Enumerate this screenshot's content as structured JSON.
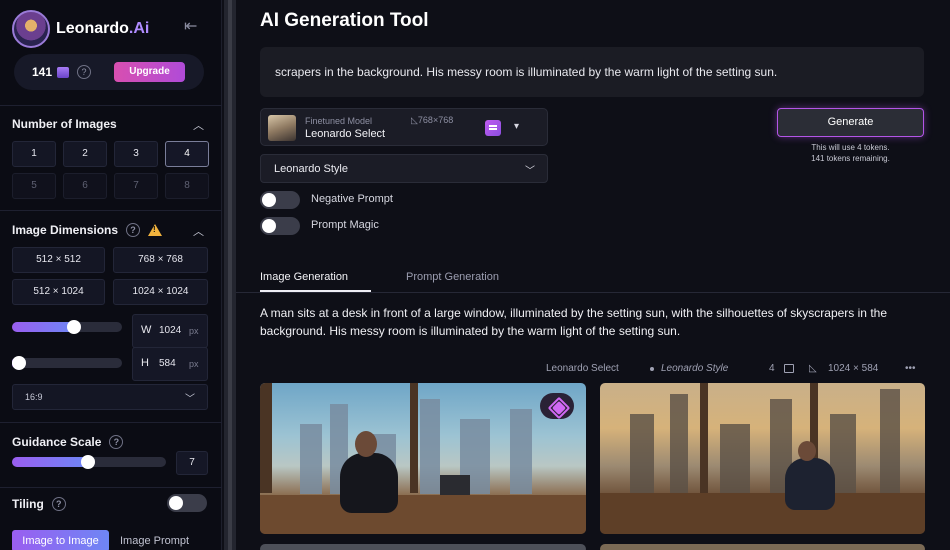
{
  "app": {
    "brand_prefix": "Leonardo",
    "brand_suffix": ".Ai",
    "collapse_icon": "arrow-left-to-line-icon"
  },
  "tokens": {
    "count": "141",
    "upgrade_label": "Upgrade"
  },
  "sidebar": {
    "num_images_title": "Number of Images",
    "num_images": [
      "1",
      "2",
      "3",
      "4",
      "5",
      "6",
      "7",
      "8"
    ],
    "num_images_selected": "4",
    "dimensions_title": "Image Dimensions",
    "dimension_presets": [
      "512 × 512",
      "768 × 768",
      "512 × 1024",
      "1024 × 1024"
    ],
    "width_label": "W",
    "width_value": "1024",
    "width_unit": "px",
    "width_slider": 0.5,
    "height_label": "H",
    "height_value": "584",
    "height_unit": "px",
    "height_slider": 0.0,
    "aspect_ratio": "16:9",
    "guidance_title": "Guidance Scale",
    "guidance_value": "7",
    "guidance_slider": 0.45,
    "tiling_title": "Tiling",
    "tiling_on": false,
    "tab_image_to_image": "Image to Image",
    "tab_image_prompt": "Image Prompt"
  },
  "main": {
    "title": "AI Generation Tool",
    "prompt_text": "scrapers in the background. His messy room is illuminated by the warm light of the setting sun.",
    "model_kicker": "Finetuned Model",
    "model_name": "Leonardo Select",
    "model_dims": "768×768",
    "style": "Leonardo Style",
    "negative_prompt_label": "Negative Prompt",
    "negative_prompt_on": false,
    "prompt_magic_label": "Prompt Magic",
    "prompt_magic_on": false,
    "generate_label": "Generate",
    "generate_note_1": "This will use 4 tokens.",
    "generate_note_2": "141 tokens remaining.",
    "tabs": [
      "Image Generation",
      "Prompt Generation"
    ],
    "active_tab": "Image Generation",
    "generation": {
      "prompt": "A man sits at a desk in front of a large window, illuminated by the setting sun, with the silhouettes of skyscrapers in the background. His messy room is illuminated by the warm light of the setting sun.",
      "model": "Leonardo Select",
      "style": "Leonardo Style",
      "count": "4",
      "dims": "1024 × 584",
      "more": "•••"
    }
  }
}
